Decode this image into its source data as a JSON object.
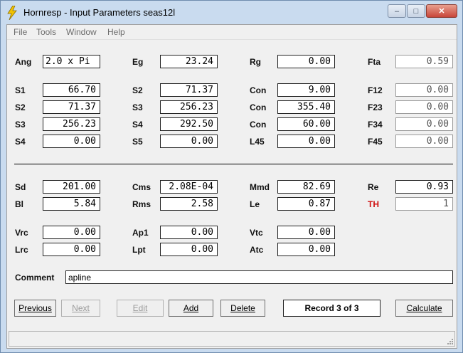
{
  "window": {
    "title": "Hornresp - Input Parameters   seas12l",
    "minimize_glyph": "–",
    "maximize_glyph": "□",
    "close_glyph": "✕",
    "icon": "lightning-bolt-icon"
  },
  "menu": {
    "file": "File",
    "tools": "Tools",
    "window": "Window",
    "help": "Help"
  },
  "params": {
    "ang": {
      "label": "Ang",
      "value": "2.0 x Pi"
    },
    "eg": {
      "label": "Eg",
      "value": "23.24"
    },
    "rg": {
      "label": "Rg",
      "value": "0.00"
    },
    "fta": {
      "label": "Fta",
      "value": "0.59"
    },
    "s1": {
      "label": "S1",
      "value": "66.70"
    },
    "s2a": {
      "label": "S2",
      "value": "71.37"
    },
    "con1": {
      "label": "Con",
      "value": "9.00"
    },
    "f12": {
      "label": "F12",
      "value": "0.00"
    },
    "s2b": {
      "label": "S2",
      "value": "71.37"
    },
    "s3a": {
      "label": "S3",
      "value": "256.23"
    },
    "con2": {
      "label": "Con",
      "value": "355.40"
    },
    "f23": {
      "label": "F23",
      "value": "0.00"
    },
    "s3b": {
      "label": "S3",
      "value": "256.23"
    },
    "s4a": {
      "label": "S4",
      "value": "292.50"
    },
    "con3": {
      "label": "Con",
      "value": "60.00"
    },
    "f34": {
      "label": "F34",
      "value": "0.00"
    },
    "s4b": {
      "label": "S4",
      "value": "0.00"
    },
    "s5": {
      "label": "S5",
      "value": "0.00"
    },
    "l45": {
      "label": "L45",
      "value": "0.00"
    },
    "f45": {
      "label": "F45",
      "value": "0.00"
    },
    "sd": {
      "label": "Sd",
      "value": "201.00"
    },
    "cms": {
      "label": "Cms",
      "value": "2.08E-04"
    },
    "mmd": {
      "label": "Mmd",
      "value": "82.69"
    },
    "re": {
      "label": "Re",
      "value": "0.93"
    },
    "bl": {
      "label": "Bl",
      "value": "5.84"
    },
    "rms": {
      "label": "Rms",
      "value": "2.58"
    },
    "le": {
      "label": "Le",
      "value": "0.87"
    },
    "th": {
      "label": "TH",
      "value": "1"
    },
    "vrc": {
      "label": "Vrc",
      "value": "0.00"
    },
    "ap1": {
      "label": "Ap1",
      "value": "0.00"
    },
    "vtc": {
      "label": "Vtc",
      "value": "0.00"
    },
    "lrc": {
      "label": "Lrc",
      "value": "0.00"
    },
    "lpt": {
      "label": "Lpt",
      "value": "0.00"
    },
    "atc": {
      "label": "Atc",
      "value": "0.00"
    }
  },
  "comment": {
    "label": "Comment",
    "value": "apline"
  },
  "buttons": {
    "previous": "Previous",
    "next": "Next",
    "edit": "Edit",
    "add": "Add",
    "delete": "Delete",
    "calculate": "Calculate"
  },
  "record": "Record 3 of 3",
  "colors": {
    "th_label": "#d01010",
    "titlebar": "#c9dbef"
  }
}
